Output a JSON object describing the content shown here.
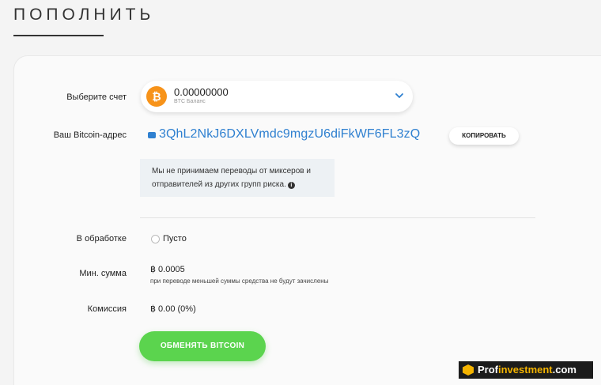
{
  "page": {
    "title": "ПОПОЛНИТЬ"
  },
  "form": {
    "account": {
      "label": "Выберите счет",
      "amount": "0.00000000",
      "caption": "BTC Баланс",
      "coin_symbol": "₿",
      "coin_icon": "bitcoin-icon",
      "chevron_icon": "chevron-down-icon"
    },
    "address": {
      "label": "Ваш Bitcoin-адрес",
      "value": "3QhL2NkJ6DXLVmdc9mgzU6diFkWF6FL3zQ",
      "copy_label": "КОПИРОВАТЬ",
      "icon": "wallet-icon"
    },
    "notice": {
      "text": "Мы не принимаем переводы от миксеров и отправителей из других групп риска.",
      "info_glyph": "i"
    },
    "processing": {
      "label": "В обработке",
      "value": "Пусто"
    },
    "min_amount": {
      "label": "Мин. сумма",
      "value": "฿ 0.0005",
      "note": "при переводе меньшей суммы средства не будут зачислены"
    },
    "fee": {
      "label": "Комиссия",
      "value": "฿ 0.00 (0%)"
    },
    "submit_label": "ОБМЕНЯТЬ BITCOIN"
  },
  "watermark": {
    "prefix": "Prof",
    "highlight": "investment",
    "suffix": ".com"
  },
  "colors": {
    "accent_blue": "#2f80d0",
    "bitcoin_orange": "#f7931a",
    "button_green": "#5bd44e"
  }
}
